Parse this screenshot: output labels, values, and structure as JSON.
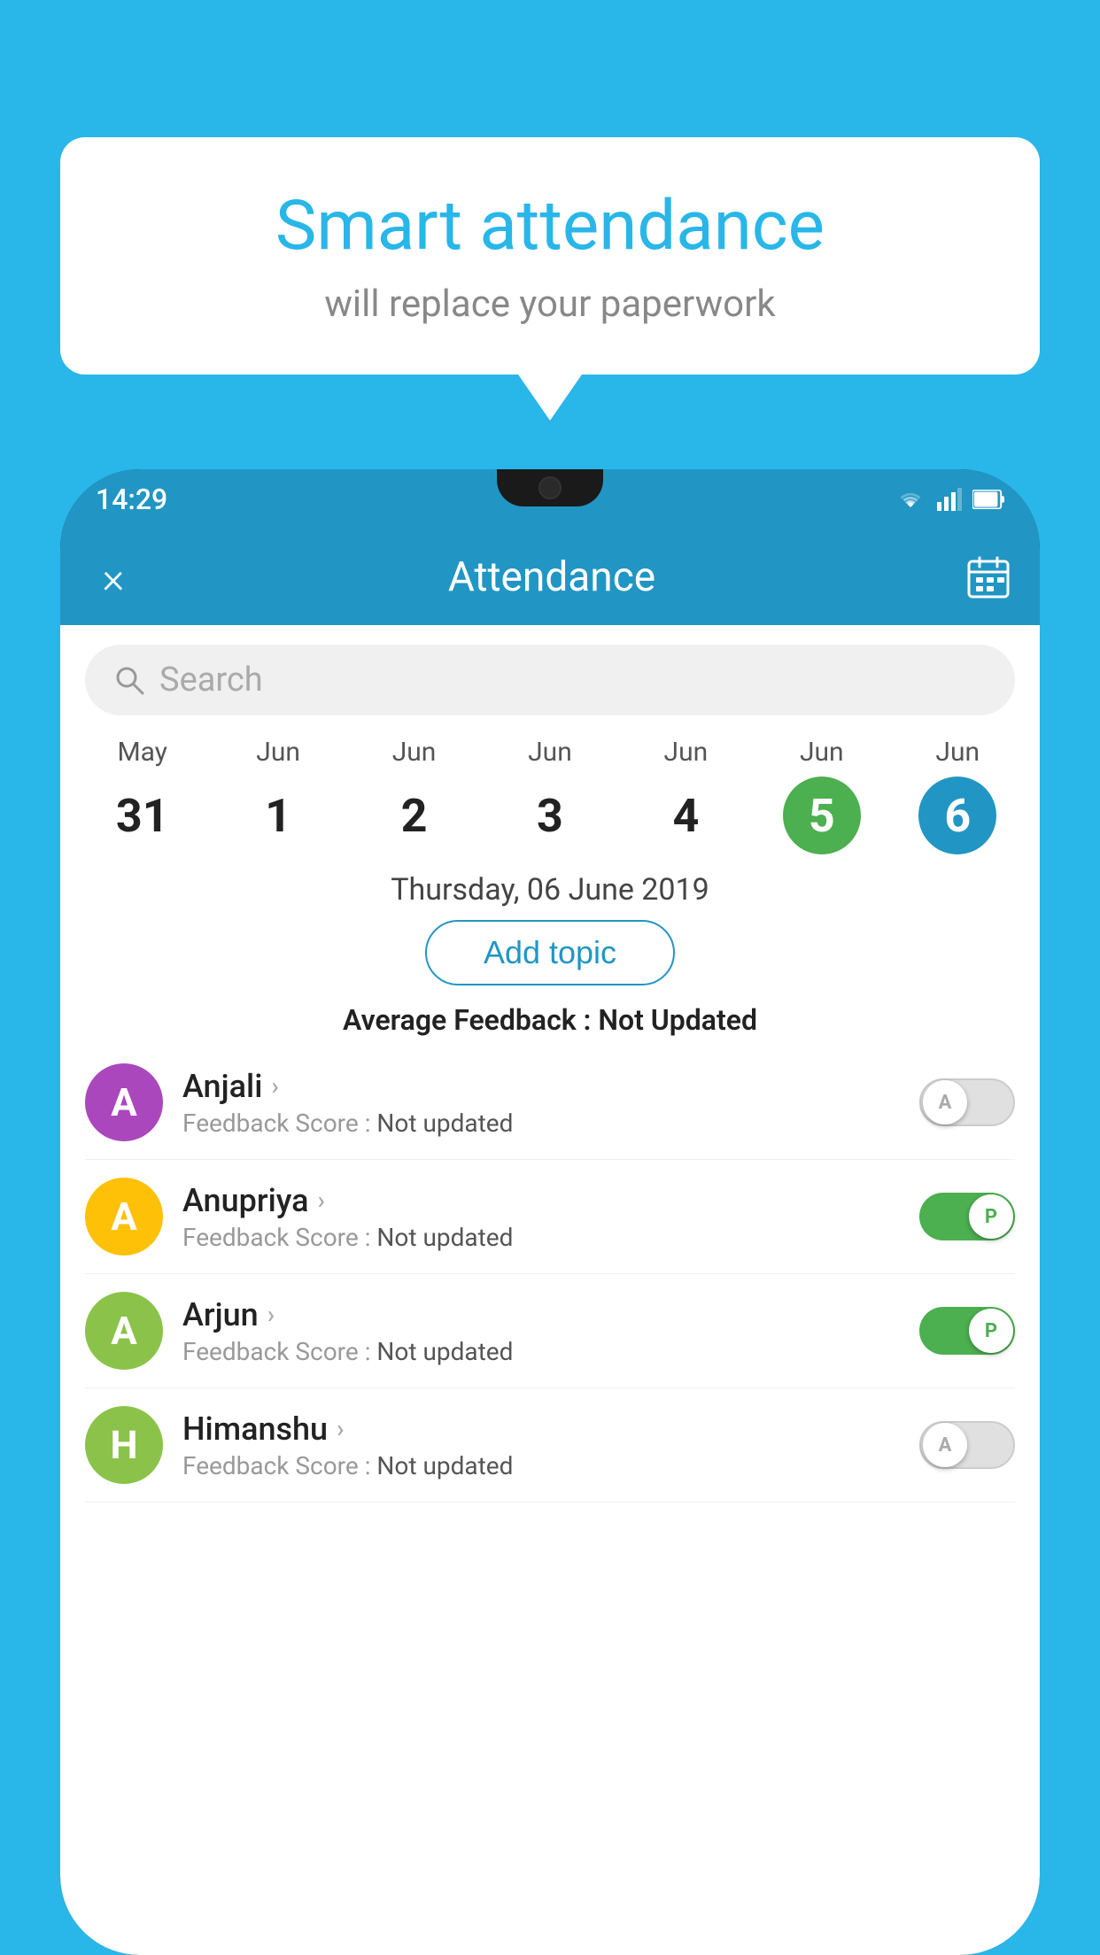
{
  "background_color": "#29b6e8",
  "speech_bubble": {
    "title": "Smart attendance",
    "subtitle": "will replace your paperwork"
  },
  "status_bar": {
    "time": "14:29"
  },
  "app_bar": {
    "title": "Attendance",
    "close_label": "×",
    "calendar_label": "calendar"
  },
  "search": {
    "placeholder": "Search"
  },
  "calendar": {
    "days": [
      {
        "month": "May",
        "date": "31",
        "state": "normal"
      },
      {
        "month": "Jun",
        "date": "1",
        "state": "normal"
      },
      {
        "month": "Jun",
        "date": "2",
        "state": "normal"
      },
      {
        "month": "Jun",
        "date": "3",
        "state": "normal"
      },
      {
        "month": "Jun",
        "date": "4",
        "state": "normal"
      },
      {
        "month": "Jun",
        "date": "5",
        "state": "today"
      },
      {
        "month": "Jun",
        "date": "6",
        "state": "selected"
      }
    ],
    "selected_date_label": "Thursday, 06 June 2019"
  },
  "add_topic_label": "Add topic",
  "average_feedback": {
    "label": "Average Feedback : ",
    "value": "Not Updated"
  },
  "students": [
    {
      "name": "Anjali",
      "avatar_letter": "A",
      "avatar_color": "#ab47bc",
      "feedback_label": "Feedback Score : ",
      "feedback_value": "Not updated",
      "toggle_state": "off",
      "toggle_letter": "A"
    },
    {
      "name": "Anupriya",
      "avatar_letter": "A",
      "avatar_color": "#ffc107",
      "feedback_label": "Feedback Score : ",
      "feedback_value": "Not updated",
      "toggle_state": "on",
      "toggle_letter": "P"
    },
    {
      "name": "Arjun",
      "avatar_letter": "A",
      "avatar_color": "#8bc34a",
      "feedback_label": "Feedback Score : ",
      "feedback_value": "Not updated",
      "toggle_state": "on",
      "toggle_letter": "P"
    },
    {
      "name": "Himanshu",
      "avatar_letter": "H",
      "avatar_color": "#8bc34a",
      "feedback_label": "Feedback Score : ",
      "feedback_value": "Not updated",
      "toggle_state": "off",
      "toggle_letter": "A"
    }
  ]
}
